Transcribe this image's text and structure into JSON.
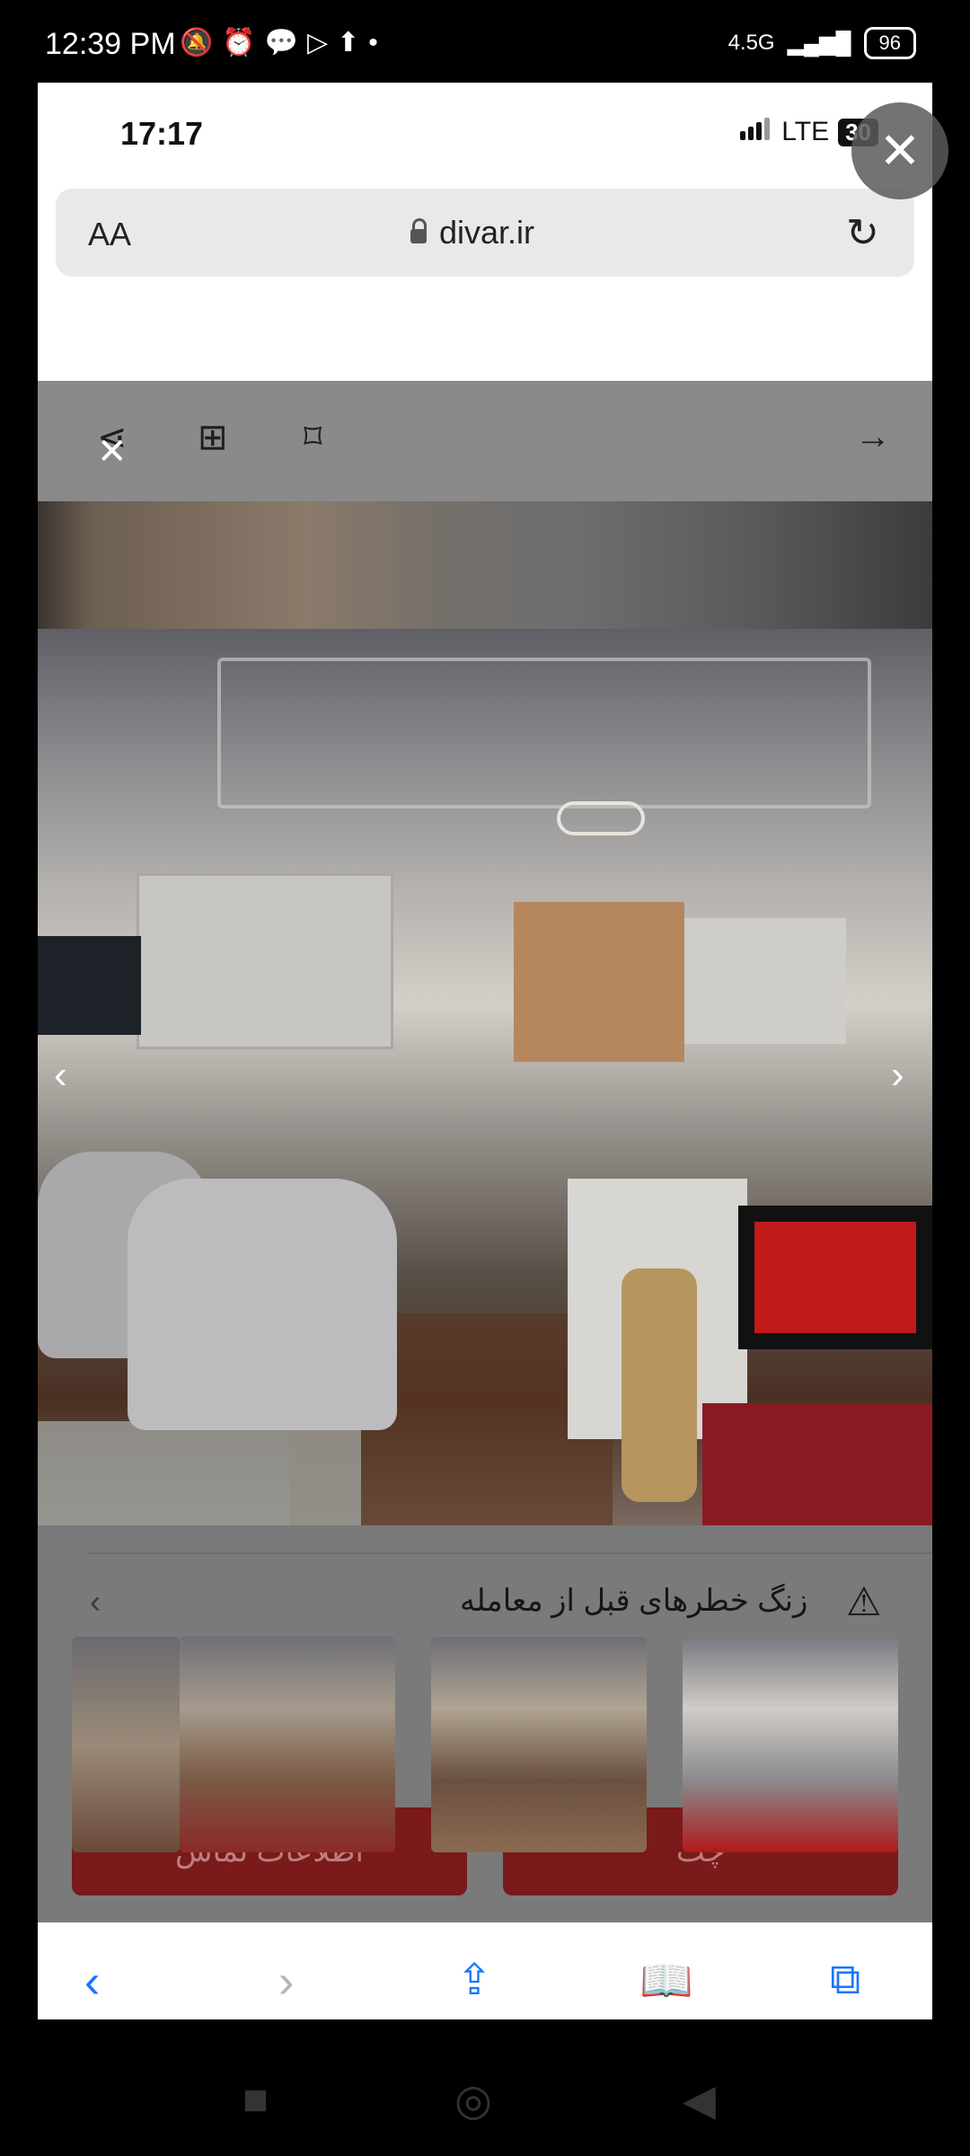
{
  "status_bar": {
    "time": "12:39 PM",
    "network": "4.5G",
    "battery": "96"
  },
  "browser": {
    "ios_time": "17:17",
    "network": "LTE",
    "badge": "30",
    "text_size_label": "AA",
    "url": "divar.ir",
    "close_symbol": "✕"
  },
  "web_toolbar": {
    "icons": [
      "share-icon",
      "add-note-icon",
      "bookmark-icon",
      "arrow-right-icon"
    ]
  },
  "listing": {
    "warning_text": "زنگ خطرهای قبل از معامله",
    "buttons": [
      {
        "label": "اطلاعات تماس"
      },
      {
        "label": "چت"
      }
    ]
  },
  "gallery": {
    "thumbnail_count": 4,
    "page_dots": 7,
    "active_dot": 6
  },
  "colors": {
    "accent": "#1a75ff",
    "action_red": "#7a1a1a"
  }
}
